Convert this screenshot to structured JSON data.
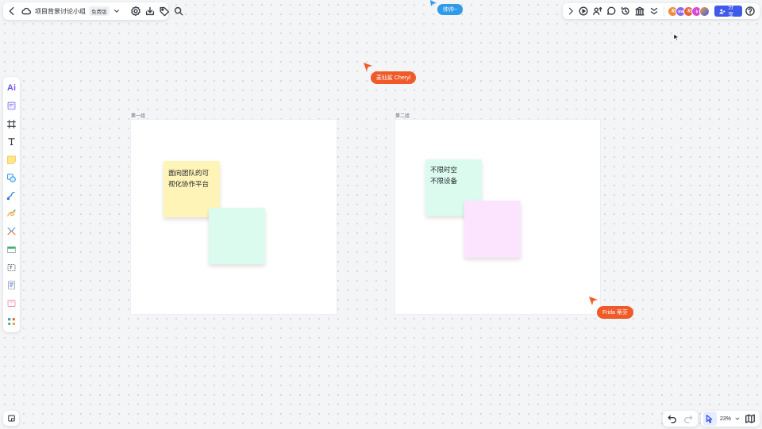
{
  "header": {
    "doc_title": "项目背景讨论小组",
    "plan_badge": "免费版"
  },
  "top_right": {
    "share_label": "分享",
    "avatars": [
      {
        "initials": "发",
        "color": "#f08c3d"
      },
      {
        "initials": "BW",
        "color": "#8b6cf0"
      },
      {
        "initials": "发",
        "color": "#e8613a"
      },
      {
        "initials": "b",
        "color": "#d84bd6"
      },
      {
        "initials": "",
        "color": "#f0a13a"
      }
    ]
  },
  "collaborators": {
    "top": {
      "name": "帅帅~",
      "color": "#2f9ae8"
    },
    "middle": {
      "name": "麦仙鲨 Cheryl",
      "color": "#f05a28"
    },
    "bottom": {
      "name": "Frida 蒂芬",
      "color": "#f05a28"
    }
  },
  "frames": [
    {
      "label": "第一组",
      "notes": [
        {
          "text": "面向团队的可视化协作平台",
          "color": "#fff4b8"
        },
        {
          "text": "",
          "color": "#dcfbef"
        }
      ]
    },
    {
      "label": "第二组",
      "notes": [
        {
          "text": "不限时空\n不限设备",
          "color": "#dcfbef"
        },
        {
          "text": "",
          "color": "#fce4ff"
        }
      ]
    }
  ],
  "zoom": {
    "level": "23%"
  }
}
